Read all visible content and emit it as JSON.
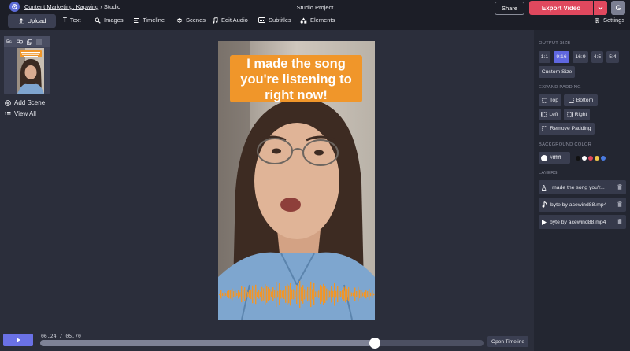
{
  "header": {
    "breadcrumb_link": "Content Marketing, Kapwing",
    "breadcrumb_sep": " › ",
    "breadcrumb_current": "Studio",
    "project_title": "Studio Project",
    "share_label": "Share",
    "export_label": "Export Video",
    "avatar_initial": "G"
  },
  "toolbar": {
    "upload": "Upload",
    "text": "Text",
    "images": "Images",
    "timeline": "Timeline",
    "scenes": "Scenes",
    "edit_audio": "Edit Audio",
    "subtitles": "Subtitles",
    "elements": "Elements",
    "settings": "Settings"
  },
  "scenes": {
    "duration": "5s",
    "add_scene": "Add Scene",
    "view_all": "View All"
  },
  "canvas": {
    "caption": "I made the song you're listening to right now!"
  },
  "playback": {
    "current_time": "06.24",
    "separator": " / ",
    "total_time": "05.70",
    "progress": 0.754,
    "open_timeline": "Open Timeline"
  },
  "right_panel": {
    "output_size_title": "OUTPUT SIZE",
    "sizes": [
      "1:1",
      "9:16",
      "16:9",
      "4:5",
      "5:4"
    ],
    "selected_size": "9:16",
    "custom_size": "Custom Size",
    "expand_padding_title": "EXPAND PADDING",
    "padding_top": "Top",
    "padding_bottom": "Bottom",
    "padding_left": "Left",
    "padding_right": "Right",
    "remove_padding": "Remove Padding",
    "background_color_title": "BACKGROUND COLOR",
    "background_color": "#ffffff",
    "swatches": [
      "#111111",
      "#ffffff",
      "#e0485e",
      "#f2c94c",
      "#4a7be0"
    ],
    "layers_title": "LAYERS",
    "layers": [
      {
        "icon": "text-icon",
        "label": "I made the song you'r..."
      },
      {
        "icon": "music-icon",
        "label": "byte by acewind88.mp4"
      },
      {
        "icon": "play-icon",
        "label": "byte by acewind88.mp4"
      }
    ]
  },
  "colors": {
    "accent": "#5f67e0",
    "export": "#e0485e",
    "caption_bg": "#f0962a",
    "waveform": "#f0962a"
  }
}
